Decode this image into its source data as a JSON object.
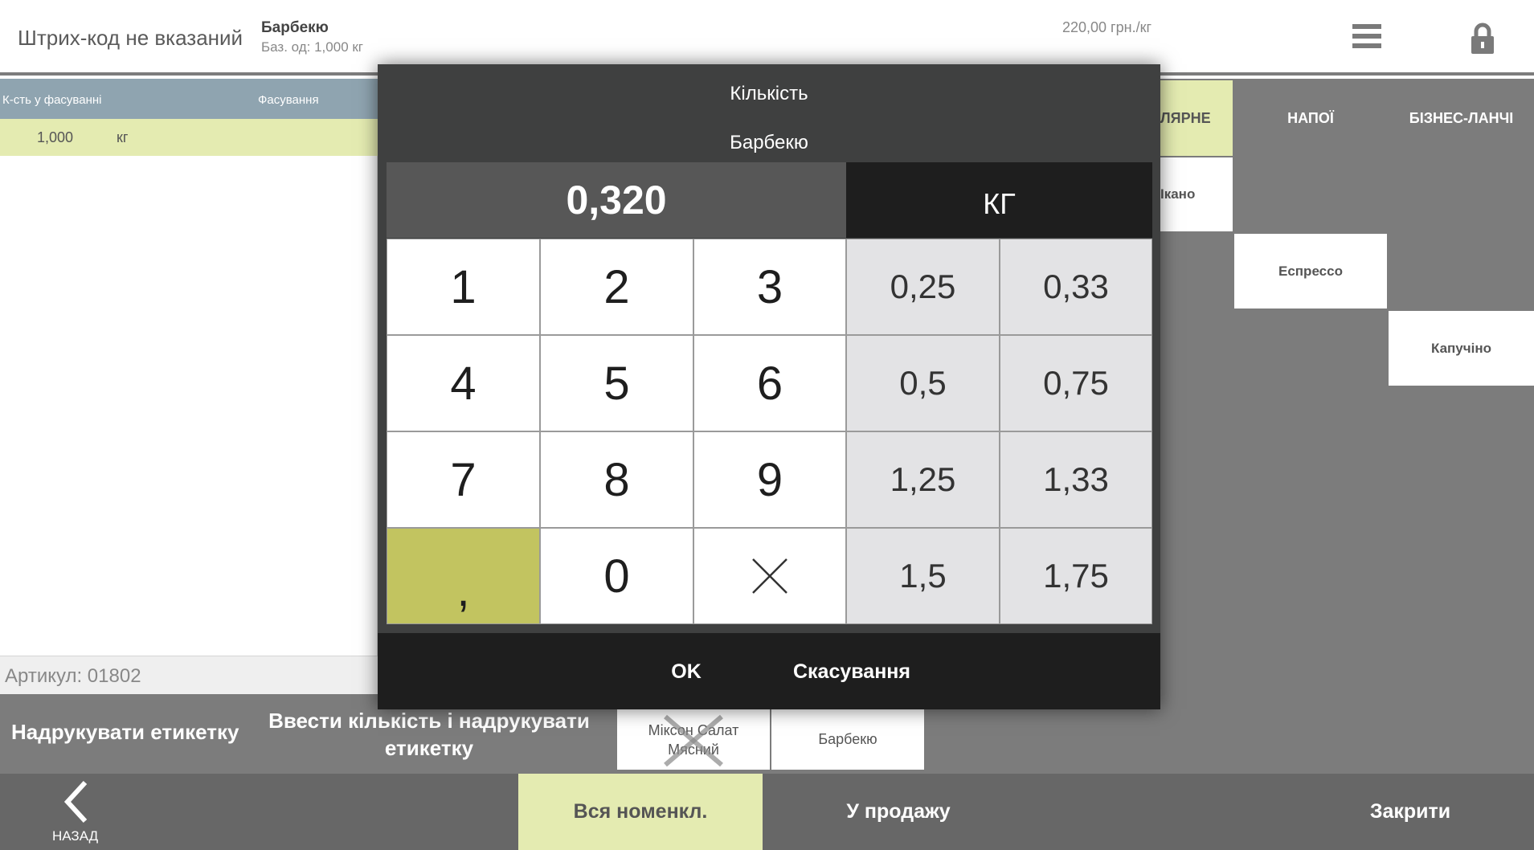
{
  "header": {
    "barcode_status": "Штрих-код не вказаний",
    "item_name": "Барбекю",
    "base_unit": "Баз. од: 1,000 кг",
    "price": "220,00 грн./кг"
  },
  "packaging_table": {
    "columns": [
      "К-сть у фасуванні",
      "Фасування"
    ],
    "rows": [
      {
        "qty": "1,000",
        "unit": "кг"
      }
    ]
  },
  "article": "Артикул: 01802",
  "categories": [
    {
      "label": "ПОПУЛЯРНЕ",
      "visible_label": "ЛЯРНЕ"
    },
    {
      "label": "НАПОЇ"
    },
    {
      "label": "БІЗНЕС-ЛАНЧІ"
    }
  ],
  "products": {
    "partial": "Ікано",
    "espresso": "Еспрессо",
    "cappuccino": "Капучіно",
    "mixon": "Міксон Салат Мясний",
    "bbq": "Барбекю"
  },
  "actions": {
    "print_label": "Надрукувати етикетку",
    "enter_and_print": "Ввести кількість і надрукувати етикетку"
  },
  "nav": {
    "back": "НАЗАД",
    "all_nomenclature": "Вся номенкл.",
    "for_sale": "У продажу",
    "close": "Закрити"
  },
  "modal": {
    "title": "Кількість",
    "item": "Барбекю",
    "value": "0,320",
    "unit": "КГ",
    "keys": {
      "k1": "1",
      "k2": "2",
      "k3": "3",
      "k4": "4",
      "k5": "5",
      "k6": "6",
      "k7": "7",
      "k8": "8",
      "k9": "9",
      "comma": ",",
      "k0": "0"
    },
    "quick": {
      "q1": "0,25",
      "q2": "0,33",
      "q3": "0,5",
      "q4": "0,75",
      "q5": "1,25",
      "q6": "1,33",
      "q7": "1,5",
      "q8": "1,75"
    },
    "ok": "OK",
    "cancel": "Скасування"
  },
  "colors": {
    "accent_yellow": "#e4ebb1",
    "comma_key": "#c2c460",
    "modal_bg": "#3f4040",
    "grey_panel": "#7c7c7c"
  }
}
